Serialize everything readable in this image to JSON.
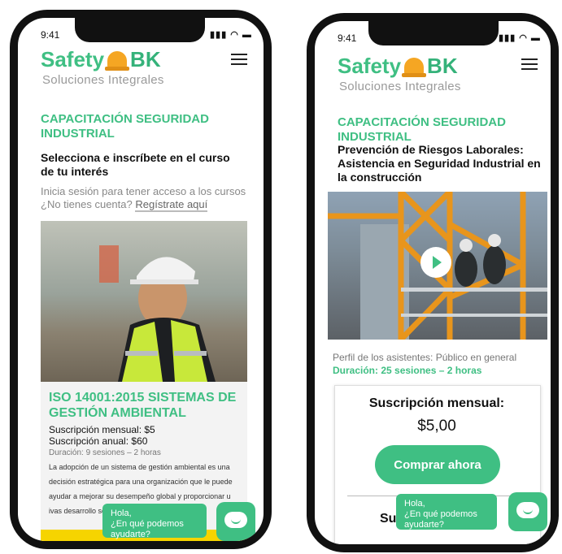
{
  "colors": {
    "accent": "#3fbf83",
    "helmet": "#f5a623",
    "yellow": "#f6d400"
  },
  "left": {
    "status_time": "9:41",
    "status_icons": "▮▮▮ ◠ ▬",
    "logo_word": "Safety",
    "logo_suffix": "BK",
    "tagline": "Soluciones Integrales",
    "heading": "CAPACITACIÓN SEGURIDAD INDUSTRIAL",
    "subheading": "Selecciona e inscríbete en  el curso de tu interés",
    "login_prompt": "Inicia sesión para tener acceso a los cursos",
    "no_account": "¿No tienes cuenta?",
    "register_link": "Regístrate aquí",
    "course_title": "ISO 14001:2015 SISTEMAS DE GESTIÓN AMBIENTAL",
    "monthly": "Suscripción mensual: $5",
    "annual": "Suscripción anual: $60",
    "duration": "Duración: 9 sesiones – 2 horas",
    "description": "La adopción de un sistema de gestión ambiental es una decisión estratégica para una organización que le puede ayudar a mejorar su desempeño global y proporcionar u                    ivas desarrollo sos",
    "chat_text": "Hola,\n¿En qué podemos ayudarte?"
  },
  "right": {
    "status_time": "9:41",
    "status_icons": "▮▮▮ ◠ ▬",
    "logo_word": "Safety",
    "logo_suffix": "BK",
    "tagline": "Soluciones Integrales",
    "heading": "CAPACITACIÓN SEGURIDAD INDUSTRIAL",
    "course_title": "Prevención de Riesgos Laborales: Asistencia en Seguridad Industrial en la construcción",
    "audience": "Perfil de los asistentes: Público en general",
    "duration": "Duración: 25 sesiones – 2 horas",
    "plan_label": "Suscripción mensual:",
    "price": "$5,00",
    "buy_label": "Comprar ahora",
    "partial_label": "Su",
    "chat_text": "Hola,\n¿En qué podemos ayudarte?"
  }
}
